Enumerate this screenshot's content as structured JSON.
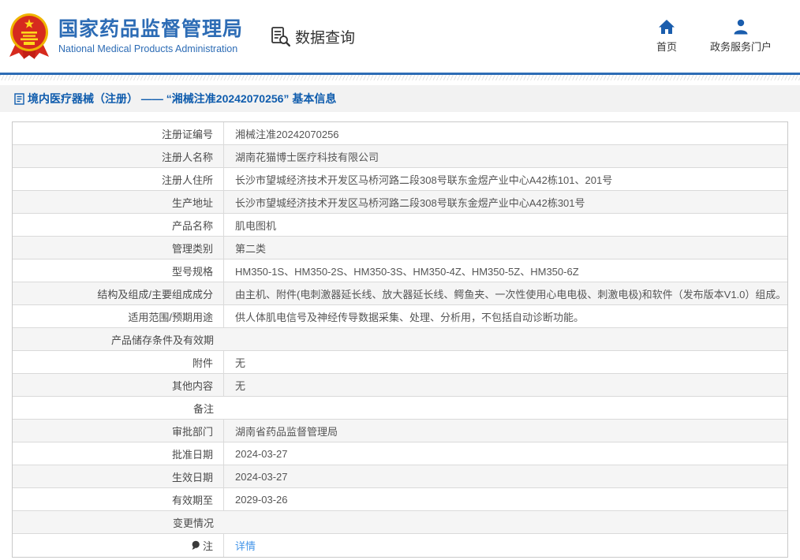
{
  "header": {
    "org_name_cn": "国家药品监督管理局",
    "org_name_en": "National Medical Products Administration",
    "section_label": "数据查询",
    "nav": [
      {
        "label": "首页",
        "icon": "home-icon"
      },
      {
        "label": "政务服务门户",
        "icon": "user-icon"
      }
    ]
  },
  "breadcrumb": {
    "icon": "document-icon",
    "text": "境内医疗器械（注册） —— “湘械注准20242070256” 基本信息"
  },
  "table": {
    "rows": [
      {
        "label": "注册证编号",
        "value": "湘械注准20242070256"
      },
      {
        "label": "注册人名称",
        "value": "湖南花猫博士医疗科技有限公司"
      },
      {
        "label": "注册人住所",
        "value": "长沙市望城经济技术开发区马桥河路二段308号联东金煜产业中心A42栋101、201号"
      },
      {
        "label": "生产地址",
        "value": "长沙市望城经济技术开发区马桥河路二段308号联东金煜产业中心A42栋301号"
      },
      {
        "label": "产品名称",
        "value": "肌电图机"
      },
      {
        "label": "管理类别",
        "value": "第二类"
      },
      {
        "label": "型号规格",
        "value": "HM350-1S、HM350-2S、HM350-3S、HM350-4Z、HM350-5Z、HM350-6Z"
      },
      {
        "label": "结构及组成/主要组成成分",
        "value": "由主机、附件(电刺激器延长线、放大器延长线、鳄鱼夹、一次性使用心电电极、刺激电极)和软件（发布版本V1.0）组成。"
      },
      {
        "label": "适用范围/预期用途",
        "value": "供人体肌电信号及神经传导数据采集、处理、分析用，不包括自动诊断功能。"
      },
      {
        "label": "产品储存条件及有效期",
        "value": ""
      },
      {
        "label": "附件",
        "value": "无"
      },
      {
        "label": "其他内容",
        "value": "无"
      },
      {
        "label": "备注",
        "value": ""
      },
      {
        "label": "审批部门",
        "value": "湖南省药品监督管理局"
      },
      {
        "label": "批准日期",
        "value": "2024-03-27"
      },
      {
        "label": "生效日期",
        "value": "2024-03-27"
      },
      {
        "label": "有效期至",
        "value": "2029-03-26"
      },
      {
        "label": "变更情况",
        "value": ""
      },
      {
        "label": "注",
        "value": "详情",
        "link": true,
        "label_icon": "note-icon"
      }
    ]
  },
  "colors": {
    "brand_blue": "#2d6cb5",
    "breadcrumb_blue": "#0f5cad",
    "link_blue": "#4495e8",
    "icon_blue": "#1a5dad",
    "row_alt_bg": "#f5f5f5",
    "breadcrumb_bg": "#f2f2f2",
    "border_gray": "#dadada",
    "emblem_red": "#d62a1e",
    "emblem_gold": "#f0b400"
  }
}
